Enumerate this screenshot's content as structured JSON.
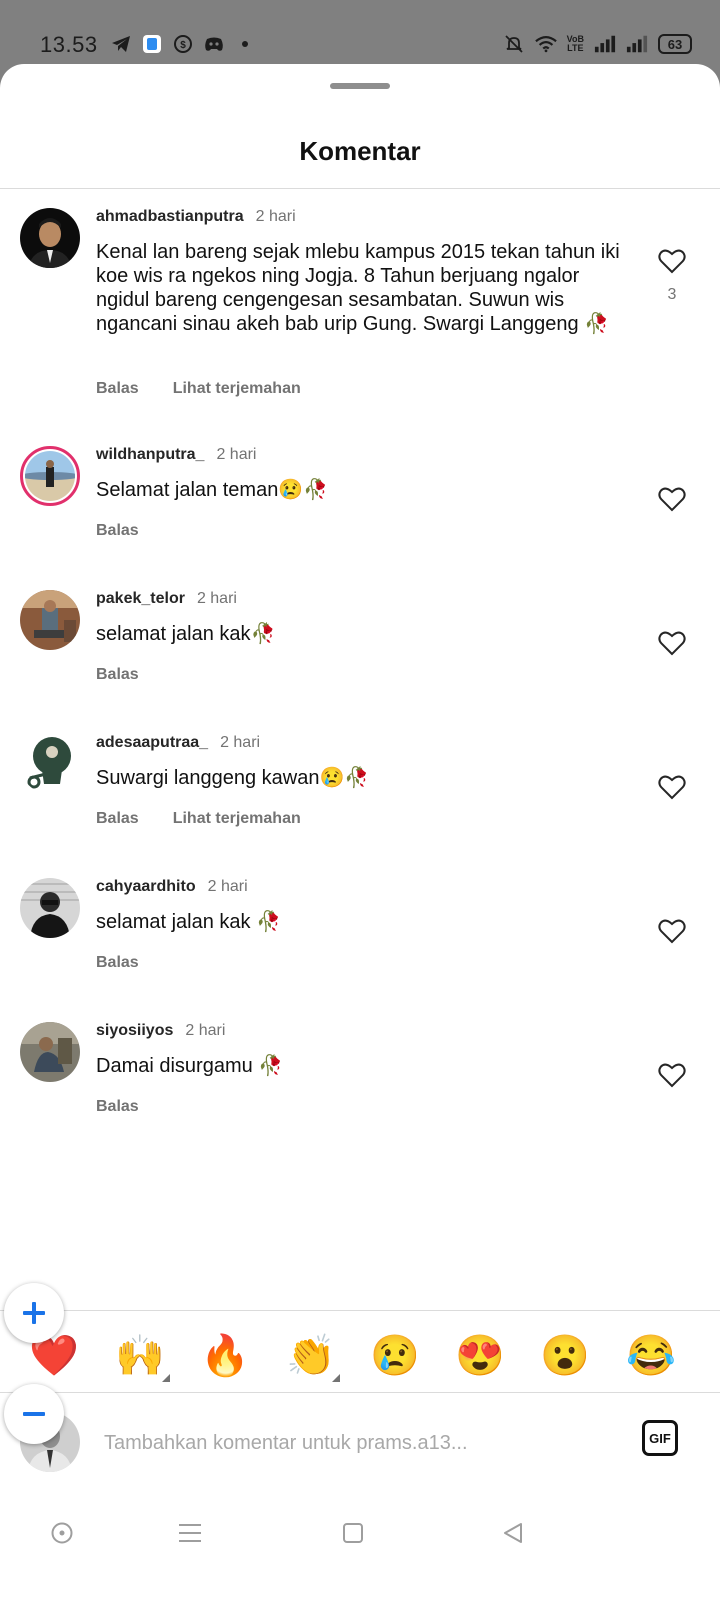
{
  "status_bar": {
    "time": "13.53",
    "battery": "63",
    "volte_top": "VoB",
    "volte_bottom": "LTE",
    "icons": [
      "telegram-icon",
      "app-icon",
      "coin-icon",
      "discord-icon",
      "dot-icon",
      "mute-icon",
      "wifi-icon",
      "volte-icon",
      "signal-icon",
      "signal-icon",
      "battery-icon"
    ]
  },
  "sheet": {
    "title": "Komentar"
  },
  "comments": [
    {
      "username": "ahmadbastianputra",
      "time": "2 hari",
      "text": "Kenal lan bareng sejak mlebu kampus 2015 tekan tahun iki koe wis ra ngekos ning Jogja. 8 Tahun berjuang ngalor ngidul bareng cengengesan sesambatan. Suwun wis ngancani sinau akeh bab urip Gung. Swargi Langgeng 🥀",
      "reply_label": "Balas",
      "translate_label": "Lihat terjemahan",
      "likes": "3"
    },
    {
      "username": "wildhanputra_",
      "time": "2 hari",
      "text": "Selamat jalan teman😢🥀",
      "reply_label": "Balas"
    },
    {
      "username": "pakek_telor",
      "time": "2 hari",
      "text": "selamat jalan kak🥀",
      "reply_label": "Balas"
    },
    {
      "username": "adesaaputraa_",
      "time": "2 hari",
      "text": "Suwargi langgeng kawan😢🥀",
      "reply_label": "Balas",
      "translate_label": "Lihat terjemahan"
    },
    {
      "username": "cahyaardhito",
      "time": "2 hari",
      "text": "selamat jalan kak 🥀",
      "reply_label": "Balas"
    },
    {
      "username": "siyosiiyos",
      "time": "2 hari",
      "text": "Damai disurgamu 🥀",
      "reply_label": "Balas"
    }
  ],
  "emoji_bar": [
    "❤️",
    "🙌",
    "🔥",
    "👏",
    "😢",
    "😍",
    "😮",
    "😂"
  ],
  "composer": {
    "placeholder": "Tambahkan komentar untuk prams.a13...",
    "gif_label": "GIF"
  },
  "zoom": {
    "plus": "+",
    "minus": "−"
  },
  "colors": {
    "accent_blue": "#1a73e8",
    "ring": "#e1306c",
    "heart_red": "#ed1c24"
  }
}
